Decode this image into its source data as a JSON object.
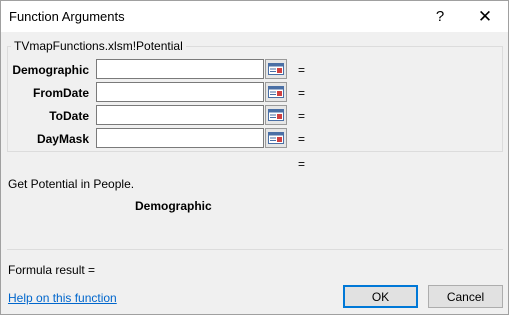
{
  "window": {
    "title": "Function Arguments",
    "help_glyph": "?",
    "close_glyph": "✕"
  },
  "group": {
    "label": "TVmapFunctions.xlsm!Potential"
  },
  "arguments": [
    {
      "label": "Demographic",
      "value": "",
      "equals": "="
    },
    {
      "label": "FromDate",
      "value": "",
      "equals": "="
    },
    {
      "label": "ToDate",
      "value": "",
      "equals": "="
    },
    {
      "label": "DayMask",
      "value": "",
      "equals": "="
    }
  ],
  "result_equals": "=",
  "description": "Get Potential in People.",
  "current_arg_name": "Demographic",
  "formula_result": "Formula result =",
  "help_link": "Help on this function",
  "buttons": {
    "ok": "OK",
    "cancel": "Cancel"
  },
  "colors": {
    "accent": "#0078d7",
    "link": "#0066cc"
  },
  "icons": {
    "ref_button": "collapse-dialog-icon"
  }
}
